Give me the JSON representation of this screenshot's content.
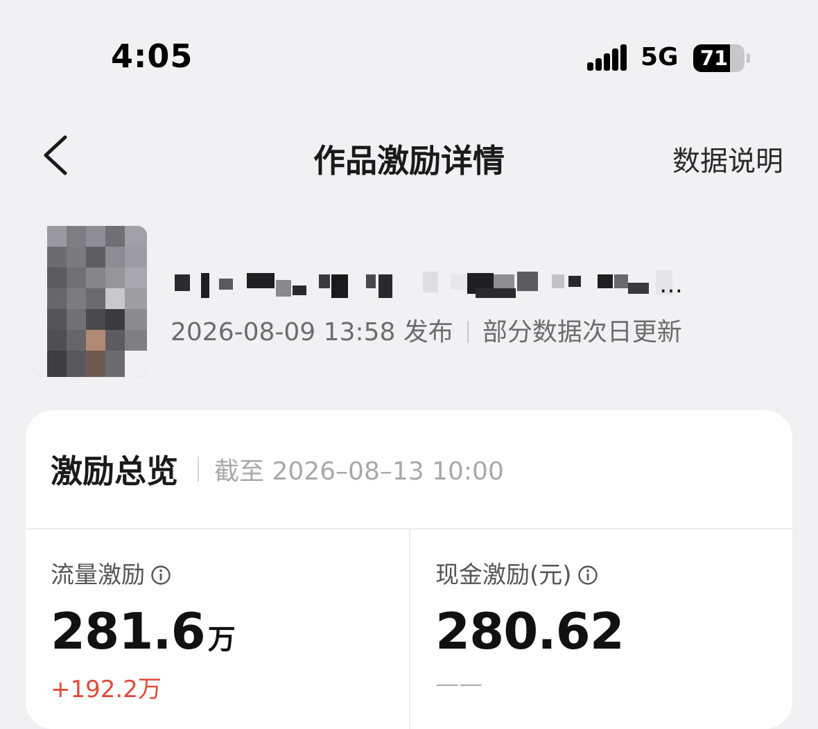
{
  "status_bar": {
    "time": "4:05",
    "network": "5G",
    "battery": "71",
    "battery_level": 0.71,
    "signal_icon": "signal-bars-icon"
  },
  "nav": {
    "back_icon": "chevron-left-icon",
    "title": "作品激励详情",
    "data_explain": "数据说明"
  },
  "work": {
    "publish_time": "2026-08-09 13:58 发布",
    "update_note": "部分数据次日更新"
  },
  "overview": {
    "title": "激励总览",
    "as_of": "截至 2026–08–13 10:00",
    "traffic": {
      "label": "流量激励",
      "value": "281.6",
      "unit": "万",
      "change": "+192.2万"
    },
    "cash": {
      "label": "现金激励(元)",
      "value": "280.62",
      "change": "——"
    },
    "info_icon": "info-circle-icon",
    "colors": {
      "increase": "#e04a3a",
      "muted": "#b0b0b4"
    }
  }
}
